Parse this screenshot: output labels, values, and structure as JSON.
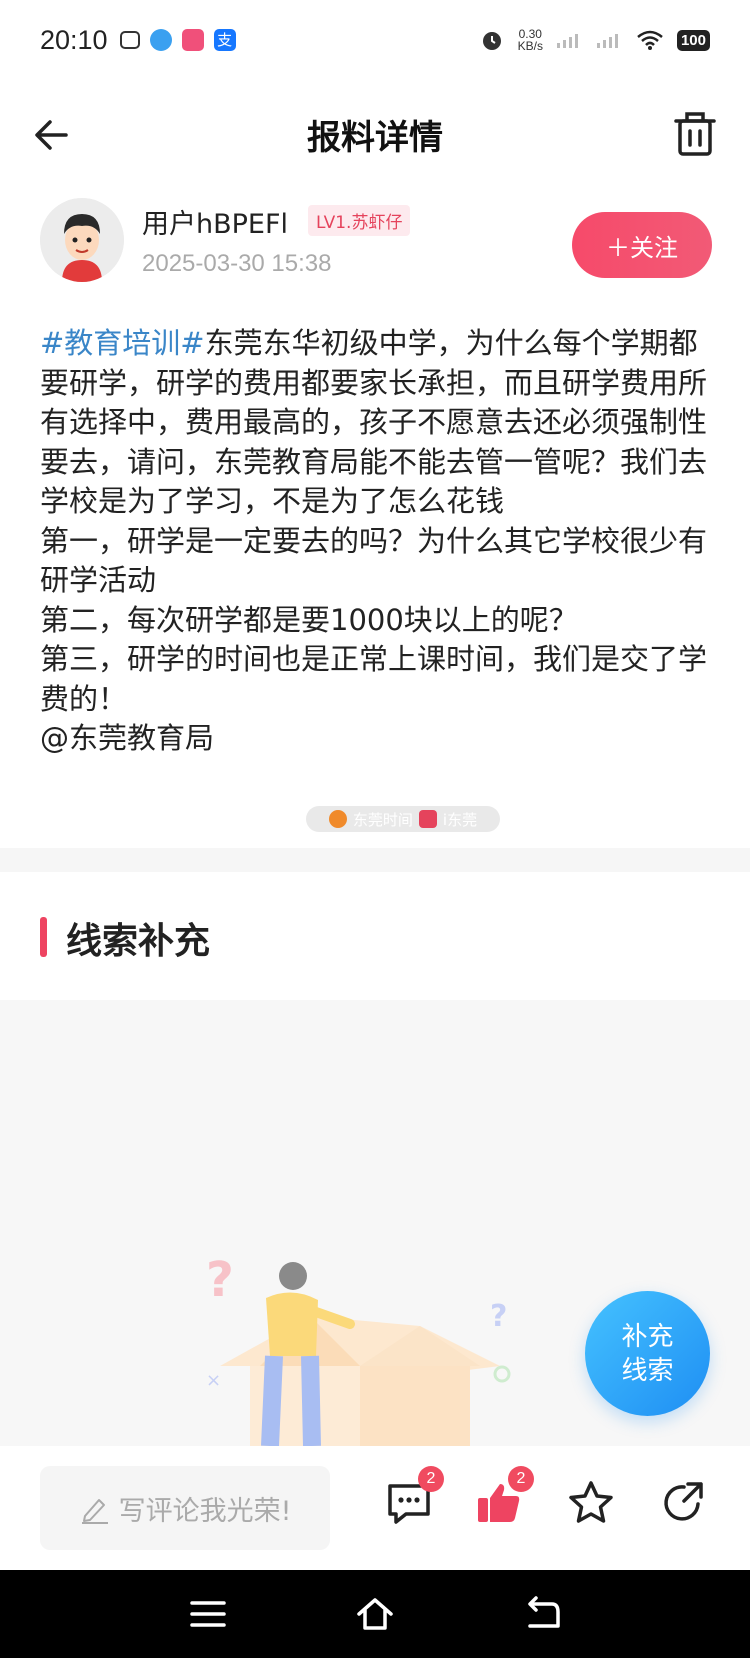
{
  "status_bar": {
    "time": "20:10",
    "net_speed_value": "0.30",
    "net_speed_unit": "KB/s",
    "battery": "100"
  },
  "nav": {
    "title": "报料详情"
  },
  "author": {
    "username": "用户hBPEFl",
    "level": "LV1.苏虾仔",
    "time": "2025-03-30 15:38",
    "follow_label": "＋关注"
  },
  "post": {
    "tag": "#教育培训#",
    "paragraphs": [
      "东莞东华初级中学，为什么每个学期都要研学，研学的费用都要家长承担，而且研学费用所有选择中，费用最高的，孩子不愿意去还必须强制性要去，请问，东莞教育局能不能去管一管呢？我们去学校是为了学习，不是为了怎么花钱",
      "第一，研学是一定要去的吗？为什么其它学校很少有研学活动",
      "第二，每次研学都是要1000块以上的呢？",
      "第三，研学的时间也是正常上课时间，我们是交了学费的！",
      "@东莞教育局"
    ]
  },
  "watermark": {
    "left": "东莞时间",
    "right": "i东莞"
  },
  "section": {
    "title": "线索补充"
  },
  "float_button": {
    "line1": "补充",
    "line2": "线索"
  },
  "bottom_bar": {
    "comment_placeholder": "写评论我光荣!",
    "comment_count": "2",
    "like_count": "2"
  },
  "colors": {
    "accent": "#ee4461",
    "tag_blue": "#3a86c8",
    "float_blue": "#1e8ef3"
  }
}
